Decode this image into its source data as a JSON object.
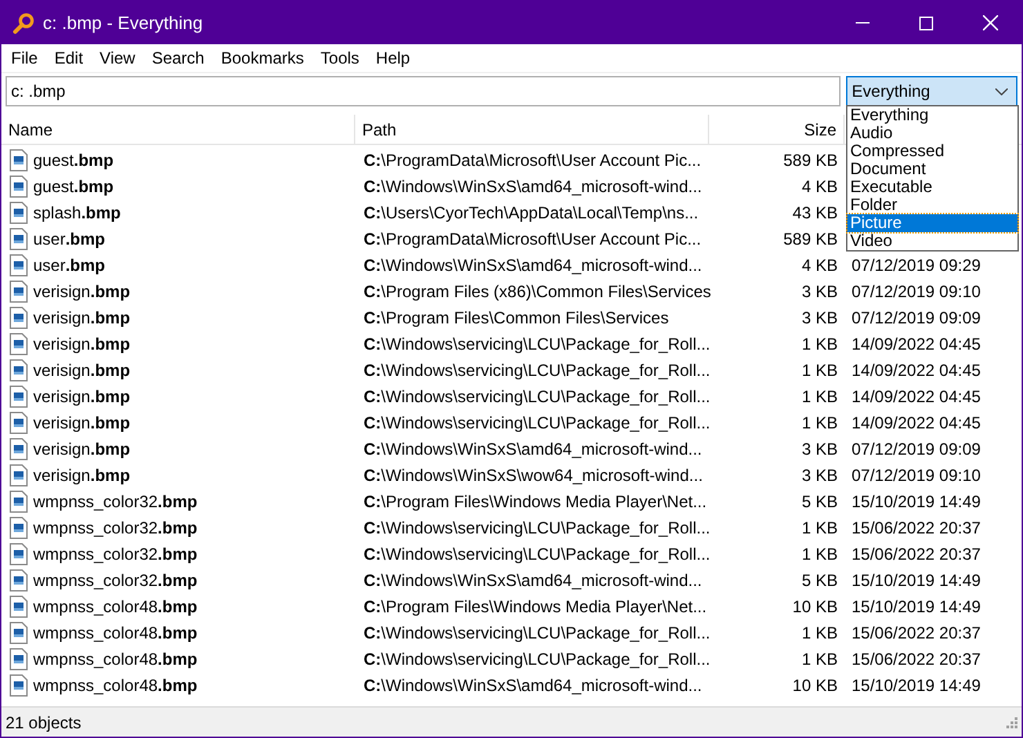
{
  "window": {
    "title": "c: .bmp - Everything"
  },
  "menu": [
    "File",
    "Edit",
    "View",
    "Search",
    "Bookmarks",
    "Tools",
    "Help"
  ],
  "search": {
    "value": "c: .bmp"
  },
  "filter": {
    "value": "Everything",
    "expanded": true,
    "options": [
      {
        "label": "Everything",
        "highlighted": false
      },
      {
        "label": "Audio",
        "highlighted": false
      },
      {
        "label": "Compressed",
        "highlighted": false
      },
      {
        "label": "Document",
        "highlighted": false
      },
      {
        "label": "Executable",
        "highlighted": false
      },
      {
        "label": "Folder",
        "highlighted": false
      },
      {
        "label": "Picture",
        "highlighted": true
      },
      {
        "label": "Video",
        "highlighted": false
      }
    ]
  },
  "table": {
    "columns": [
      "Name",
      "Path",
      "Size"
    ],
    "rows": [
      {
        "name": "guest**.bmp**",
        "path": "**C:**\\ProgramData\\Microsoft\\User Account Pic...",
        "size": "589 KB"
      },
      {
        "name": "guest**.bmp**",
        "path": "**C:**\\Windows\\WinSxS\\amd64_microsoft-wind...",
        "size": "4 KB"
      },
      {
        "name": "splash**.bmp**",
        "path": "**C:**\\Users\\CyorTech\\AppData\\Local\\Temp\\ns...",
        "size": "43 KB"
      },
      {
        "name": "user**.bmp**",
        "path": "**C:**\\ProgramData\\Microsoft\\User Account Pic...",
        "size": "589 KB"
      },
      {
        "name": "user**.bmp**",
        "path": "**C:**\\Windows\\WinSxS\\amd64_microsoft-wind...",
        "size": "4 KB",
        "modified": "07/12/2019 09:29"
      },
      {
        "name": "verisign**.bmp**",
        "path": "**C:**\\Program Files (x86)\\Common Files\\Services",
        "size": "3 KB",
        "modified": "07/12/2019 09:10"
      },
      {
        "name": "verisign**.bmp**",
        "path": "**C:**\\Program Files\\Common Files\\Services",
        "size": "3 KB",
        "modified": "07/12/2019 09:09"
      },
      {
        "name": "verisign**.bmp**",
        "path": "**C:**\\Windows\\servicing\\LCU\\Package_for_Roll...",
        "size": "1 KB",
        "modified": "14/09/2022 04:45"
      },
      {
        "name": "verisign**.bmp**",
        "path": "**C:**\\Windows\\servicing\\LCU\\Package_for_Roll...",
        "size": "1 KB",
        "modified": "14/09/2022 04:45"
      },
      {
        "name": "verisign**.bmp**",
        "path": "**C:**\\Windows\\servicing\\LCU\\Package_for_Roll...",
        "size": "1 KB",
        "modified": "14/09/2022 04:45"
      },
      {
        "name": "verisign**.bmp**",
        "path": "**C:**\\Windows\\servicing\\LCU\\Package_for_Roll...",
        "size": "1 KB",
        "modified": "14/09/2022 04:45"
      },
      {
        "name": "verisign**.bmp**",
        "path": "**C:**\\Windows\\WinSxS\\amd64_microsoft-wind...",
        "size": "3 KB",
        "modified": "07/12/2019 09:09"
      },
      {
        "name": "verisign**.bmp**",
        "path": "**C:**\\Windows\\WinSxS\\wow64_microsoft-wind...",
        "size": "3 KB",
        "modified": "07/12/2019 09:10"
      },
      {
        "name": "wmpnss_color32**.bmp**",
        "path": "**C:**\\Program Files\\Windows Media Player\\Net...",
        "size": "5 KB",
        "modified": "15/10/2019 14:49"
      },
      {
        "name": "wmpnss_color32**.bmp**",
        "path": "**C:**\\Windows\\servicing\\LCU\\Package_for_Roll...",
        "size": "1 KB",
        "modified": "15/06/2022 20:37"
      },
      {
        "name": "wmpnss_color32**.bmp**",
        "path": "**C:**\\Windows\\servicing\\LCU\\Package_for_Roll...",
        "size": "1 KB",
        "modified": "15/06/2022 20:37"
      },
      {
        "name": "wmpnss_color32**.bmp**",
        "path": "**C:**\\Windows\\WinSxS\\amd64_microsoft-wind...",
        "size": "5 KB",
        "modified": "15/10/2019 14:49"
      },
      {
        "name": "wmpnss_color48**.bmp**",
        "path": "**C:**\\Program Files\\Windows Media Player\\Net...",
        "size": "10 KB",
        "modified": "15/10/2019 14:49"
      },
      {
        "name": "wmpnss_color48**.bmp**",
        "path": "**C:**\\Windows\\servicing\\LCU\\Package_for_Roll...",
        "size": "1 KB",
        "modified": "15/06/2022 20:37"
      },
      {
        "name": "wmpnss_color48**.bmp**",
        "path": "**C:**\\Windows\\servicing\\LCU\\Package_for_Roll...",
        "size": "1 KB",
        "modified": "15/06/2022 20:37"
      },
      {
        "name": "wmpnss_color48**.bmp**",
        "path": "**C:**\\Windows\\WinSxS\\amd64_microsoft-wind...",
        "size": "10 KB",
        "modified": "15/10/2019 14:49"
      }
    ]
  },
  "status_bar": "21 objects"
}
